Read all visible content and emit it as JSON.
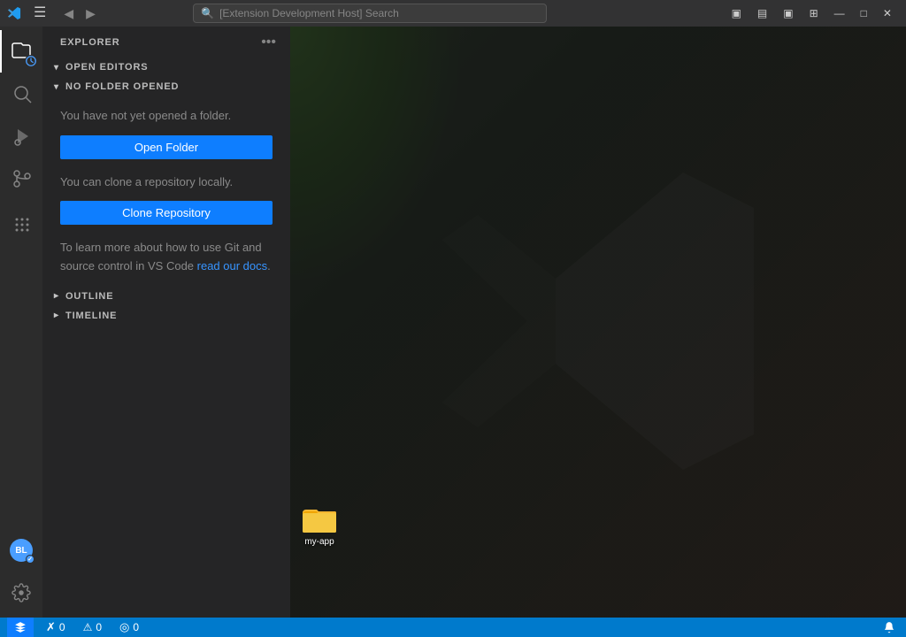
{
  "titlebar": {
    "search_placeholder": "[Extension Development Host] Search",
    "back_label": "◀",
    "forward_label": "▶",
    "layout_icons": [
      "▣",
      "▤",
      "▣",
      "⊞"
    ],
    "window_controls": {
      "minimize": "—",
      "maximize": "□",
      "close": "✕"
    }
  },
  "activity_bar": {
    "items": [
      {
        "name": "explorer",
        "icon": "files",
        "active": true
      },
      {
        "name": "search",
        "icon": "search"
      },
      {
        "name": "run-debug",
        "icon": "debug"
      },
      {
        "name": "source-control",
        "icon": "git"
      },
      {
        "name": "extensions",
        "icon": "dots"
      }
    ],
    "avatar_initials": "BL",
    "gear_label": "Manage"
  },
  "sidebar": {
    "title": "EXPLORER",
    "more_button_label": "•••",
    "sections": {
      "open_editors": {
        "label": "OPEN EDITORS",
        "collapsed": false
      },
      "no_folder": {
        "label": "NO FOLDER OPENED",
        "collapsed": false,
        "intro_text": "You have not yet opened a folder.",
        "open_folder_button": "Open Folder",
        "clone_intro_text": "You can clone a repository locally.",
        "clone_button": "Clone Repository",
        "learn_text_prefix": "To learn more about how to use Git and source control in VS Code ",
        "learn_link_text": "read our docs",
        "learn_text_suffix": "."
      },
      "outline": {
        "label": "OUTLINE",
        "collapsed": true
      },
      "timeline": {
        "label": "TIMELINE",
        "collapsed": true
      }
    }
  },
  "editor": {
    "placeholder": "vscode_logo_bg"
  },
  "statusbar": {
    "remote_label": "⚡",
    "remote_text": "",
    "errors": "0",
    "warnings": "0",
    "info": "0",
    "error_icon": "✗",
    "warning_icon": "⚠",
    "info_icon": "◎",
    "bell_icon": "🔔",
    "status_icon_label": ""
  },
  "desktop": {
    "folder_name": "my-app"
  }
}
